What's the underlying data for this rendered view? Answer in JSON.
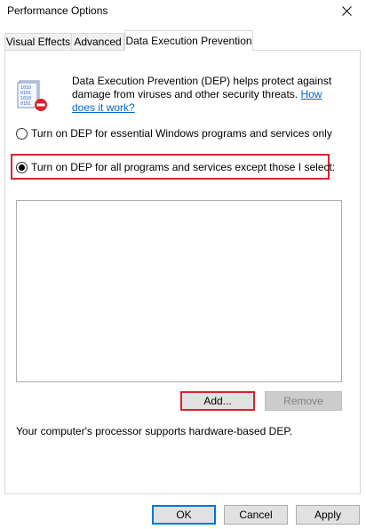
{
  "window": {
    "title": "Performance Options"
  },
  "tabs": [
    {
      "label": "Visual Effects",
      "active": false
    },
    {
      "label": "Advanced",
      "active": false
    },
    {
      "label": "Data Execution Prevention",
      "active": true
    }
  ],
  "dep": {
    "info_text": "Data Execution Prevention (DEP) helps protect against damage from viruses and other security threats.",
    "info_link": "How does it work?",
    "option_essential": "Turn on DEP for essential Windows programs and services only",
    "option_all": "Turn on DEP for all programs and services except those I select:",
    "selected_option": "all",
    "add_button": "Add...",
    "remove_button": "Remove",
    "processor_text": "Your computer's processor supports hardware-based DEP."
  },
  "dialog_buttons": {
    "ok": "OK",
    "cancel": "Cancel",
    "apply": "Apply"
  },
  "colors": {
    "highlight": "#d9232d",
    "link": "#0066cc",
    "default_button_border": "#0078d7"
  },
  "icons": {
    "close": "close-icon",
    "dep": "dep-shield-icon"
  }
}
